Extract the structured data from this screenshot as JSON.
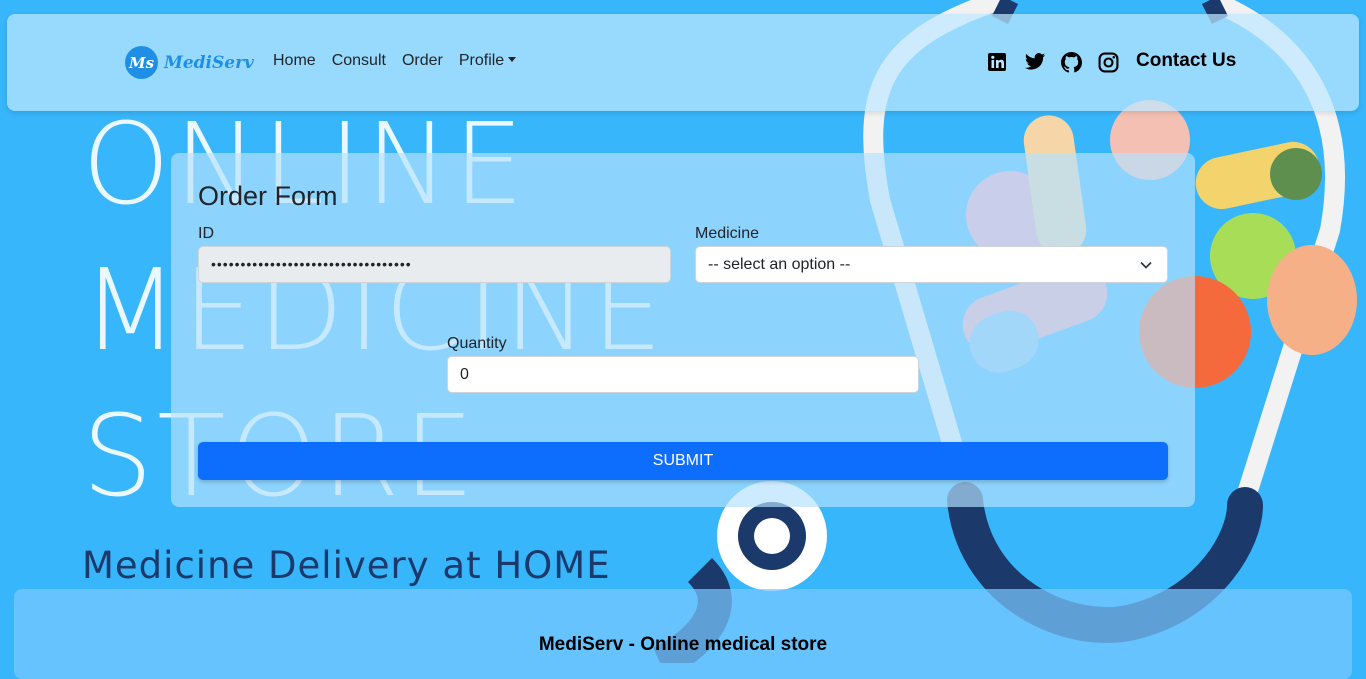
{
  "brand": {
    "badge": "Ms",
    "name": "MediServ"
  },
  "nav": {
    "home": "Home",
    "consult": "Consult",
    "order": "Order",
    "profile": "Profile"
  },
  "social_icons": [
    "linkedin-icon",
    "twitter-icon",
    "github-icon",
    "instagram-icon"
  ],
  "contact": "Contact Us",
  "background": {
    "headline_lines": [
      "ONLINE",
      "MEDICINE",
      "STORE"
    ],
    "tagline": "Medicine Delivery at HOME"
  },
  "form": {
    "title": "Order Form",
    "id_label": "ID",
    "id_value": "••••••••••••••••••••••••••••••••••",
    "medicine_label": "Medicine",
    "medicine_selected": "-- select an option --",
    "quantity_label": "Quantity",
    "quantity_value": "0",
    "submit": "SUBMIT"
  },
  "footer": {
    "text": "MediServ - Online medical store"
  },
  "colors": {
    "page_bg": "#38b6fb",
    "brand": "#1f8fe6",
    "submit_bg": "#0d6efd",
    "dark_navy": "#1b3a6b"
  }
}
